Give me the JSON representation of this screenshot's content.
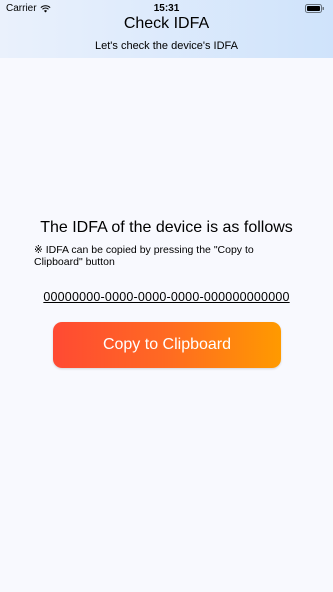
{
  "status_bar": {
    "carrier": "Carrier",
    "wifi_icon": "wifi-icon",
    "time": "15:31",
    "battery_icon": "battery-icon"
  },
  "header": {
    "title": "Check IDFA",
    "subtitle": "Let's check the device's IDFA",
    "gradient_start": "#eaf1fc",
    "gradient_end": "#cfe3fb"
  },
  "main": {
    "heading": "The IDFA of the device is as follows",
    "note": "※ IDFA can be copied by pressing the \"Copy to Clipboard\" button",
    "idfa": "00000000-0000-0000-0000-000000000000",
    "copy_button_label": "Copy to Clipboard",
    "button_colors": [
      "#ff4a33",
      "#ff9a00"
    ]
  }
}
